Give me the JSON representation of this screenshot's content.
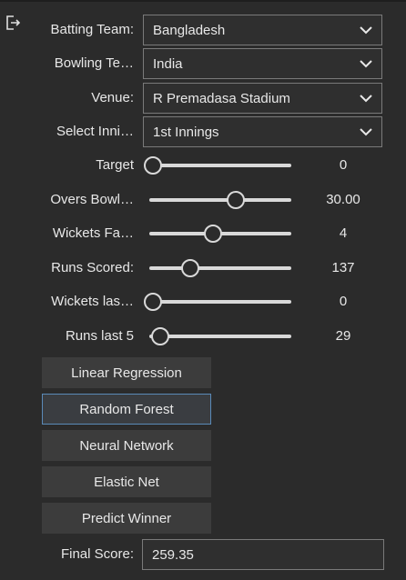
{
  "form": {
    "batting_team": {
      "label": "Batting Team:",
      "value": "Bangladesh"
    },
    "bowling_team": {
      "label": "Bowling Te…",
      "value": "India"
    },
    "venue": {
      "label": "Venue:",
      "value": "R Premadasa Stadium"
    },
    "innings": {
      "label": "Select Inni…",
      "value": "1st Innings"
    }
  },
  "sliders": {
    "target": {
      "label": "Target",
      "value": "0",
      "fraction": 0.0
    },
    "overs": {
      "label": "Overs Bowl…",
      "value": "30.00",
      "fraction": 0.6
    },
    "wickets": {
      "label": "Wickets Fa…",
      "value": "4",
      "fraction": 0.44
    },
    "runs": {
      "label": "Runs Scored:",
      "value": "137",
      "fraction": 0.28
    },
    "wickets_last": {
      "label": "Wickets las…",
      "value": "0",
      "fraction": 0.0
    },
    "runs_last5": {
      "label": "Runs last 5",
      "value": "29",
      "fraction": 0.07
    }
  },
  "buttons": {
    "linear": "Linear Regression",
    "forest": "Random Forest",
    "neural": "Neural Network",
    "elastic": "Elastic Net",
    "predict": "Predict Winner"
  },
  "result": {
    "label": "Final Score:",
    "value": "259.35"
  },
  "icons": {
    "exit": "exit-icon",
    "dropdown": "chevron-down-icon"
  },
  "colors": {
    "background": "#2b2b2b",
    "button": "#3c3c3c",
    "focus_border": "#5a8ab8",
    "track": "#d9d9d9"
  }
}
